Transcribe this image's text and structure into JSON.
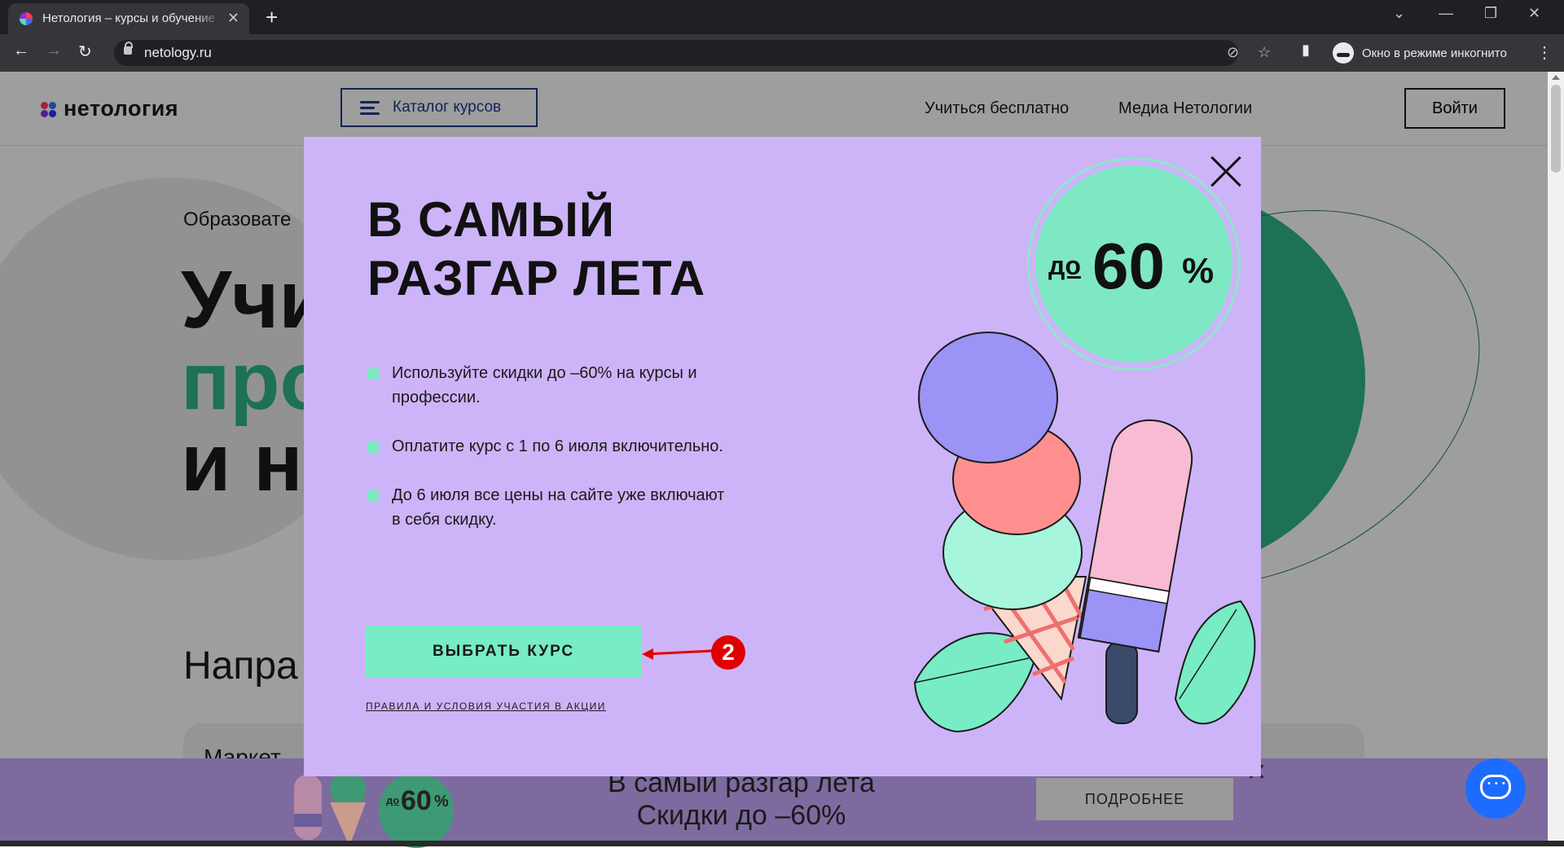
{
  "browser": {
    "tab_title": "Нетология – курсы и обучение",
    "url": "netology.ru",
    "incognito_label": "Окно в режиме инкогнито"
  },
  "header": {
    "logo_text": "нетология",
    "catalog_label": "Каталог курсов",
    "nav": [
      "Учиться бесплатно",
      "Медиа Нетологии"
    ],
    "login_label": "Войти"
  },
  "hero": {
    "subtitle_fragment": "Образовате",
    "line1": "Учи",
    "line2": "про",
    "line3": "и н",
    "section_title_fragment": "Напра",
    "card_title_fragment": "Маркет"
  },
  "modal": {
    "title_line1": "В САМЫЙ",
    "title_line2": "РАЗГАР ЛЕТА",
    "bullets": [
      "Используйте скидки до –60% на курсы и профессии.",
      "Оплатите курс с 1 по 6 июля включительно.",
      "До 6 июля все цены на сайте уже включают в себя скидку."
    ],
    "cta_label": "ВЫБРАТЬ КУРС",
    "terms_label": "ПРАВИЛА И УСЛОВИЯ УЧАСТИЯ В АКЦИИ",
    "badge_prefix": "до",
    "badge_value": "60",
    "badge_suffix": "%"
  },
  "banner": {
    "title_line1": "В самый разгар лета",
    "title_line2": "Скидки до –60%",
    "button_label": "ПОДРОБНЕЕ",
    "badge_prefix": "до",
    "badge_value": "60",
    "badge_suffix": "%"
  },
  "annotation": {
    "step_number": "2"
  },
  "colors": {
    "modal_bg": "#cdb4f8",
    "accent_mint": "#78ecc4",
    "brand_blue": "#1e3a8a",
    "annotation_red": "#e00000"
  }
}
